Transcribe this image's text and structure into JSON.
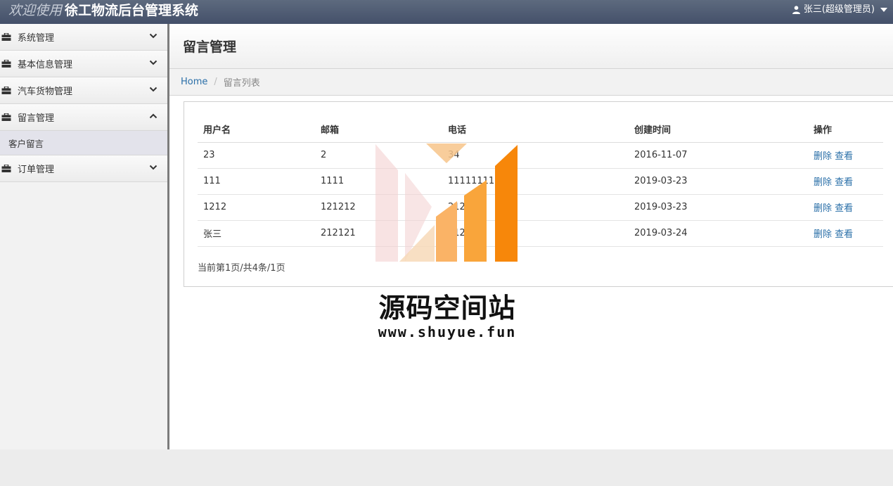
{
  "header": {
    "welcome": "欢迎使用",
    "system_name": "徐工物流后台管理系统",
    "user_label": "张三(超级管理员)"
  },
  "sidebar": {
    "items": [
      {
        "label": "系统管理",
        "expanded": false
      },
      {
        "label": "基本信息管理",
        "expanded": false
      },
      {
        "label": "汽车货物管理",
        "expanded": false
      },
      {
        "label": "留言管理",
        "expanded": true,
        "children": [
          {
            "label": "客户留言"
          }
        ]
      },
      {
        "label": "订单管理",
        "expanded": false
      }
    ]
  },
  "page": {
    "title": "留言管理",
    "breadcrumb": {
      "home": "Home",
      "current": "留言列表"
    }
  },
  "table": {
    "headers": [
      "用户名",
      "邮箱",
      "电话",
      "创建时间",
      "操作"
    ],
    "rows": [
      {
        "username": "23",
        "email": "2",
        "phone": "34",
        "created": "2016-11-07"
      },
      {
        "username": "111",
        "email": "1111",
        "phone": "1111111111",
        "created": "2019-03-23"
      },
      {
        "username": "1212",
        "email": "121212",
        "phone": "212",
        "created": "2019-03-23"
      },
      {
        "username": "张三",
        "email": "212121",
        "phone": "212",
        "created": "2019-03-24"
      }
    ],
    "actions": {
      "delete": "删除",
      "view": "查看"
    },
    "pagination": "当前第1页/共4条/1页"
  },
  "watermark": {
    "title": "源码空间站",
    "url": "www.shuyue.fun"
  },
  "colors": {
    "topbar": "#4e5a70",
    "link": "#2a6fa8",
    "watermark_orange": "#f7870a"
  }
}
